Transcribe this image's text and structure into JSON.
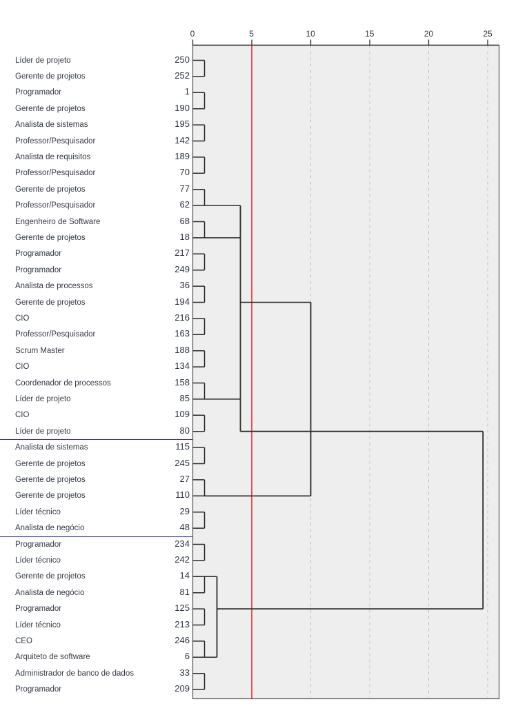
{
  "chart_data": {
    "type": "dendrogram",
    "title": "",
    "xlabel": "",
    "ylabel": "",
    "axis": {
      "ticks": [
        0,
        5,
        10,
        15,
        20,
        25
      ],
      "tick_labels": [
        "0",
        "5",
        "10",
        "15",
        "20",
        "25"
      ],
      "range": [
        0,
        26
      ],
      "position": "top",
      "gridlines": "dashed vertical at 10, 15, 20, 25"
    },
    "threshold_line": {
      "value": 5,
      "color": "#ff0000"
    },
    "cluster_dividers": {
      "color": "#2b2fbe",
      "after_row_indices": [
        23,
        29
      ]
    },
    "plot_background": "#eeeeee",
    "plot_border": "#555555",
    "link_color": "#2b2b2b",
    "leaves": [
      {
        "label": "Líder de projeto",
        "id": "250"
      },
      {
        "label": "Gerente de projetos",
        "id": "252"
      },
      {
        "label": "Programador",
        "id": "1"
      },
      {
        "label": "Gerente de projetos",
        "id": "190"
      },
      {
        "label": "Analista de sistemas",
        "id": "195"
      },
      {
        "label": "Professor/Pesquisador",
        "id": "142"
      },
      {
        "label": "Analista de requisitos",
        "id": "189"
      },
      {
        "label": "Professor/Pesquisador",
        "id": "70"
      },
      {
        "label": "Gerente de projetos",
        "id": "77"
      },
      {
        "label": "Professor/Pesquisador",
        "id": "62"
      },
      {
        "label": "Engenheiro de Software",
        "id": "68"
      },
      {
        "label": "Gerente de projetos",
        "id": "18"
      },
      {
        "label": "Programador",
        "id": "217"
      },
      {
        "label": "Programador",
        "id": "249"
      },
      {
        "label": "Analista de processos",
        "id": "36"
      },
      {
        "label": "Gerente de projetos",
        "id": "194"
      },
      {
        "label": "CIO",
        "id": "216"
      },
      {
        "label": "Professor/Pesquisador",
        "id": "163"
      },
      {
        "label": "Scrum Master",
        "id": "188"
      },
      {
        "label": "CIO",
        "id": "134"
      },
      {
        "label": "Coordenador de processos",
        "id": "158"
      },
      {
        "label": "Líder de projeto",
        "id": "85"
      },
      {
        "label": "CIO",
        "id": "109"
      },
      {
        "label": "Líder de projeto",
        "id": "80"
      },
      {
        "label": "Analista de sistemas",
        "id": "115"
      },
      {
        "label": "Gerente de projetos",
        "id": "245"
      },
      {
        "label": "Gerente de projetos",
        "id": "27"
      },
      {
        "label": "Gerente de projetos",
        "id": "110"
      },
      {
        "label": "Líder técnico",
        "id": "29"
      },
      {
        "label": "Analista de negócio",
        "id": "48"
      },
      {
        "label": "Programador",
        "id": "234"
      },
      {
        "label": "Líder técnico",
        "id": "242"
      },
      {
        "label": "Gerente de projetos",
        "id": "14"
      },
      {
        "label": "Analista de negócio",
        "id": "81"
      },
      {
        "label": "Programador",
        "id": "125"
      },
      {
        "label": "Líder técnico",
        "id": "213"
      },
      {
        "label": "CEO",
        "id": "246"
      },
      {
        "label": "Arquiteto de software",
        "id": "6"
      },
      {
        "label": "Administrador de banco de dados",
        "id": "33"
      },
      {
        "label": "Programador",
        "id": "209"
      }
    ],
    "merges": [
      {
        "rows": [
          0,
          1
        ],
        "height": 0.5
      },
      {
        "rows": [
          2,
          3
        ],
        "height": 0.5
      },
      {
        "rows": [
          4,
          5
        ],
        "height": 0.5
      },
      {
        "rows": [
          6,
          7
        ],
        "height": 0.5
      },
      {
        "rows": [
          8,
          9
        ],
        "height": 0.5
      },
      {
        "rows": [
          10,
          11
        ],
        "height": 0.5
      },
      {
        "rows": [
          12,
          13
        ],
        "height": 0.5
      },
      {
        "rows": [
          14,
          15
        ],
        "height": 0.5
      },
      {
        "rows": [
          16,
          17
        ],
        "height": 0.5
      },
      {
        "rows": [
          18,
          19
        ],
        "height": 0.5
      },
      {
        "rows": [
          20,
          21
        ],
        "height": 0.5
      },
      {
        "rows": [
          22,
          23
        ],
        "height": 0.5
      },
      {
        "rows": [
          24,
          25
        ],
        "height": 0.5
      },
      {
        "rows": [
          26,
          27
        ],
        "height": 0.5
      },
      {
        "rows": [
          28,
          29
        ],
        "height": 0.5
      },
      {
        "rows": [
          30,
          31
        ],
        "height": 0.5
      },
      {
        "rows": [
          32,
          33
        ],
        "height": 0.5
      },
      {
        "rows": [
          34,
          35
        ],
        "height": 0.5
      },
      {
        "rows": [
          36,
          37
        ],
        "height": 0.5
      },
      {
        "rows": [
          38,
          39
        ],
        "height": 0.5
      },
      {
        "label": "cluster-62-18",
        "height": 4.0
      },
      {
        "label": "cluster-217-85",
        "height": 4.55
      },
      {
        "label": "cluster-mid",
        "height": 10.0
      },
      {
        "label": "cluster-234-125",
        "height": 2.1
      },
      {
        "label": "root",
        "height": 24.6
      }
    ]
  }
}
